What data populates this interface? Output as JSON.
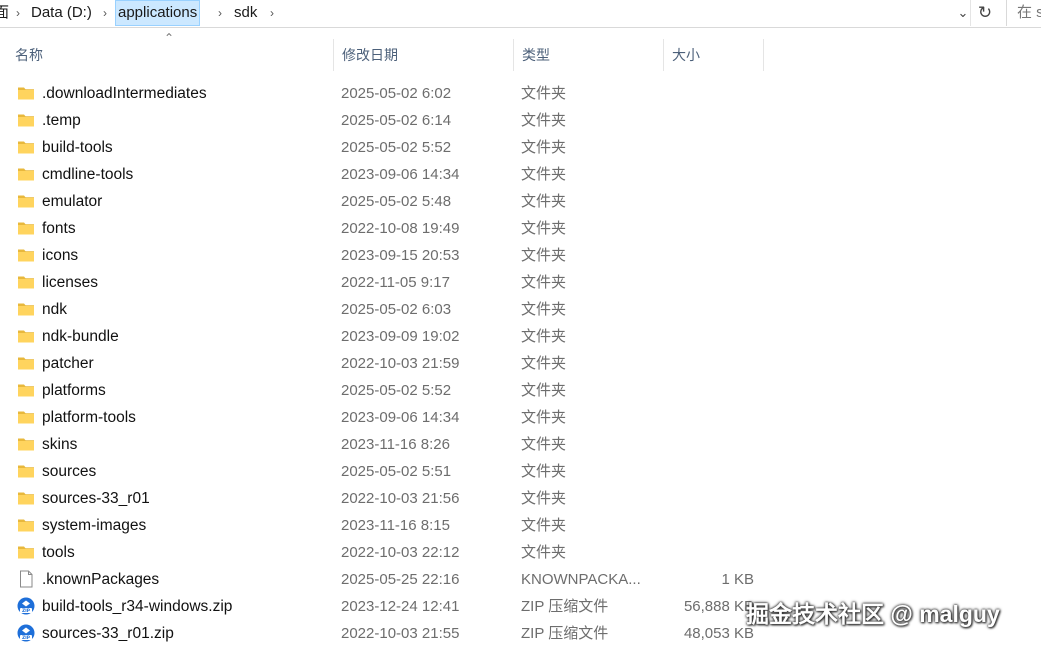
{
  "address_bar": {
    "crumb_prefix": "面",
    "crumbs": [
      "Data (D:)",
      "applications",
      "sdk"
    ],
    "search_placeholder": "在 s"
  },
  "columns": {
    "name": "名称",
    "date": "修改日期",
    "type": "类型",
    "size": "大小"
  },
  "files": [
    {
      "name": ".downloadIntermediates",
      "date": "2025-05-02 6:02",
      "type": "文件夹",
      "size": "",
      "icon": "folder-icon"
    },
    {
      "name": ".temp",
      "date": "2025-05-02 6:14",
      "type": "文件夹",
      "size": "",
      "icon": "folder-icon"
    },
    {
      "name": "build-tools",
      "date": "2025-05-02 5:52",
      "type": "文件夹",
      "size": "",
      "icon": "folder-icon"
    },
    {
      "name": "cmdline-tools",
      "date": "2023-09-06 14:34",
      "type": "文件夹",
      "size": "",
      "icon": "folder-icon"
    },
    {
      "name": "emulator",
      "date": "2025-05-02 5:48",
      "type": "文件夹",
      "size": "",
      "icon": "folder-icon"
    },
    {
      "name": "fonts",
      "date": "2022-10-08 19:49",
      "type": "文件夹",
      "size": "",
      "icon": "folder-icon"
    },
    {
      "name": "icons",
      "date": "2023-09-15 20:53",
      "type": "文件夹",
      "size": "",
      "icon": "folder-icon"
    },
    {
      "name": "licenses",
      "date": "2022-11-05 9:17",
      "type": "文件夹",
      "size": "",
      "icon": "folder-icon"
    },
    {
      "name": "ndk",
      "date": "2025-05-02 6:03",
      "type": "文件夹",
      "size": "",
      "icon": "folder-icon"
    },
    {
      "name": "ndk-bundle",
      "date": "2023-09-09 19:02",
      "type": "文件夹",
      "size": "",
      "icon": "folder-icon"
    },
    {
      "name": "patcher",
      "date": "2022-10-03 21:59",
      "type": "文件夹",
      "size": "",
      "icon": "folder-icon"
    },
    {
      "name": "platforms",
      "date": "2025-05-02 5:52",
      "type": "文件夹",
      "size": "",
      "icon": "folder-icon"
    },
    {
      "name": "platform-tools",
      "date": "2023-09-06 14:34",
      "type": "文件夹",
      "size": "",
      "icon": "folder-icon"
    },
    {
      "name": "skins",
      "date": "2023-11-16 8:26",
      "type": "文件夹",
      "size": "",
      "icon": "folder-icon"
    },
    {
      "name": "sources",
      "date": "2025-05-02 5:51",
      "type": "文件夹",
      "size": "",
      "icon": "folder-icon"
    },
    {
      "name": "sources-33_r01",
      "date": "2022-10-03 21:56",
      "type": "文件夹",
      "size": "",
      "icon": "folder-icon"
    },
    {
      "name": "system-images",
      "date": "2023-11-16 8:15",
      "type": "文件夹",
      "size": "",
      "icon": "folder-icon"
    },
    {
      "name": "tools",
      "date": "2022-10-03 22:12",
      "type": "文件夹",
      "size": "",
      "icon": "folder-icon"
    },
    {
      "name": ".knownPackages",
      "date": "2025-05-25 22:16",
      "type": "KNOWNPACKA...",
      "size": "1 KB",
      "icon": "file-icon"
    },
    {
      "name": "build-tools_r34-windows.zip",
      "date": "2023-12-24 12:41",
      "type": "ZIP 压缩文件",
      "size": "56,888 KB",
      "icon": "zip-icon"
    },
    {
      "name": "sources-33_r01.zip",
      "date": "2022-10-03 21:55",
      "type": "ZIP 压缩文件",
      "size": "48,053 KB",
      "icon": "zip-icon"
    }
  ],
  "watermark": "掘金技术社区 @ malguy"
}
